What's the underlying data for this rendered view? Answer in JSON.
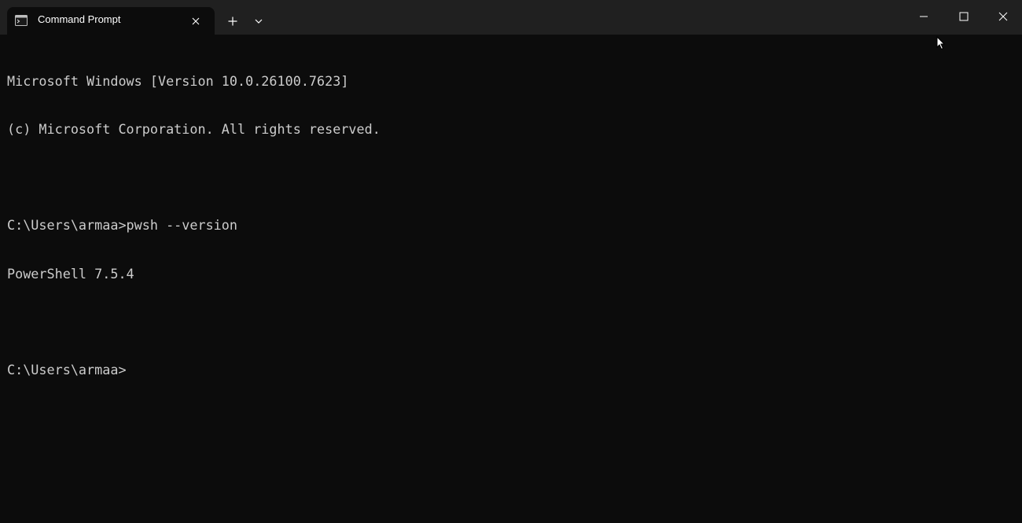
{
  "window": {
    "tab_title": "Command Prompt"
  },
  "icons": {
    "tab_icon": "terminal-icon",
    "tab_close": "close-icon",
    "new_tab": "plus-icon",
    "dropdown": "chevron-down-icon",
    "minimize": "minimize-icon",
    "maximize": "maximize-icon",
    "close": "close-icon"
  },
  "colors": {
    "titlebar_bg": "#202020",
    "terminal_bg": "#0c0c0c",
    "text": "#cccccc"
  },
  "terminal": {
    "lines": [
      "Microsoft Windows [Version 10.0.26100.7623]",
      "(c) Microsoft Corporation. All rights reserved.",
      "",
      "C:\\Users\\armaa>pwsh --version",
      "PowerShell 7.5.4",
      "",
      "C:\\Users\\armaa>"
    ]
  }
}
